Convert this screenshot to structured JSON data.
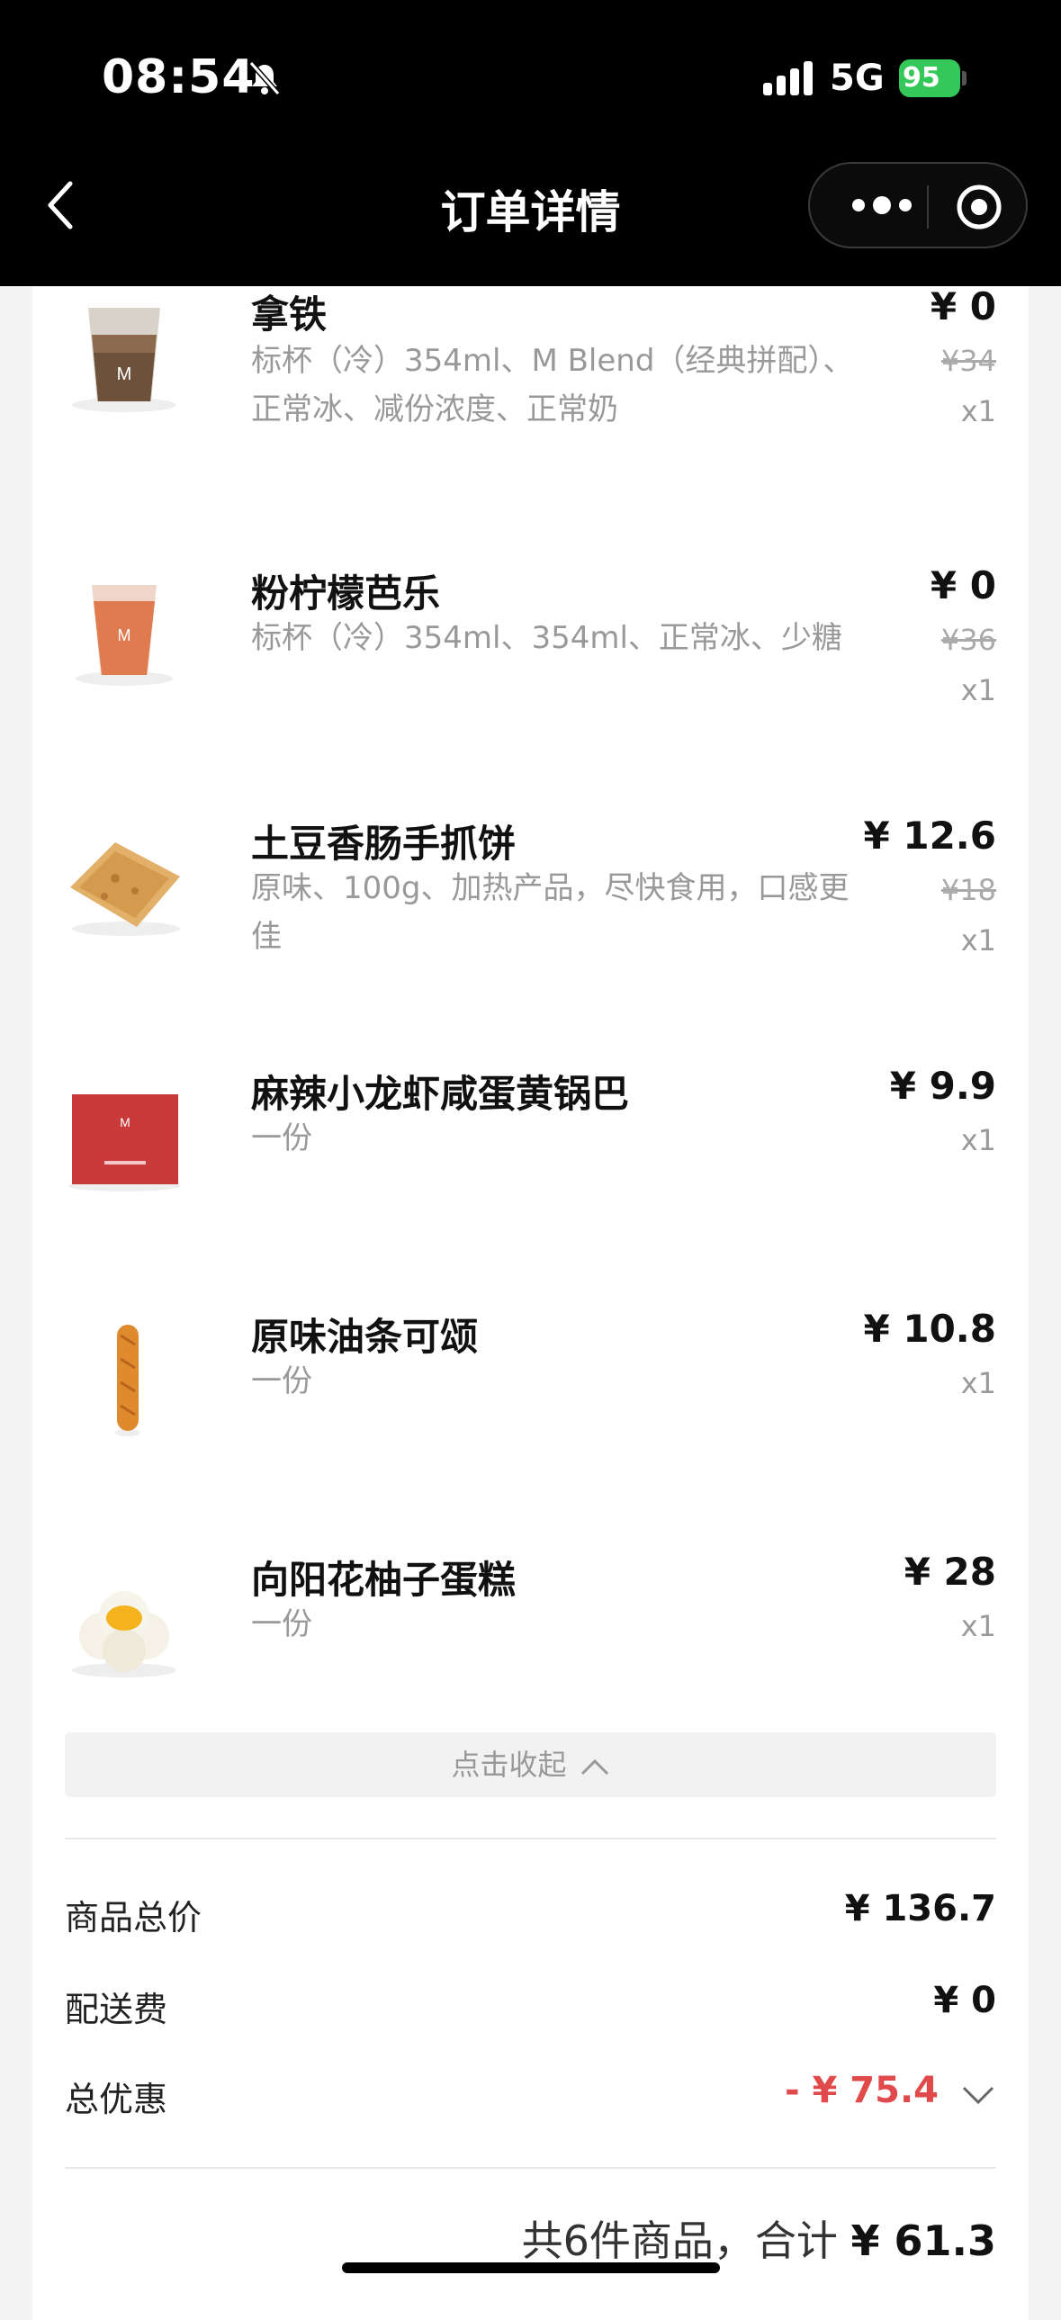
{
  "status_bar": {
    "time": "08:54",
    "network": "5G",
    "battery": "95"
  },
  "header": {
    "title": "订单详情"
  },
  "items": [
    {
      "name": "拿铁",
      "desc": "标杯（冷）354ml、M Blend（经典拼配）、正常冰、减份浓度、正常奶",
      "price": "¥ 0",
      "original": "¥34",
      "qty": "x1"
    },
    {
      "name": "粉柠檬芭乐",
      "desc": "标杯（冷）354ml、354ml、正常冰、少糖",
      "price": "¥ 0",
      "original": "¥36",
      "qty": "x1"
    },
    {
      "name": "土豆香肠手抓饼",
      "desc": "原味、100g、加热产品，尽快食用，口感更佳",
      "price": "¥ 12.6",
      "original": "¥18",
      "qty": "x1"
    },
    {
      "name": "麻辣小龙虾咸蛋黄锅巴",
      "desc": "一份",
      "price": "¥ 9.9",
      "original": "",
      "qty": "x1"
    },
    {
      "name": "原味油条可颂",
      "desc": "一份",
      "price": "¥ 10.8",
      "original": "",
      "qty": "x1"
    },
    {
      "name": "向阳花柚子蛋糕",
      "desc": "一份",
      "price": "¥ 28",
      "original": "",
      "qty": "x1"
    }
  ],
  "collapse_label": "点击收起",
  "summary": {
    "subtotal_label": "商品总价",
    "subtotal": "¥ 136.7",
    "delivery_label": "配送费",
    "delivery": "¥ 0",
    "discount_label": "总优惠",
    "discount": "- ¥ 75.4"
  },
  "footer": {
    "count_text": "共6件商品，合计",
    "total": "¥ 61.3"
  },
  "colors": {
    "discount": "#e04a4a",
    "battery": "#34c759"
  }
}
